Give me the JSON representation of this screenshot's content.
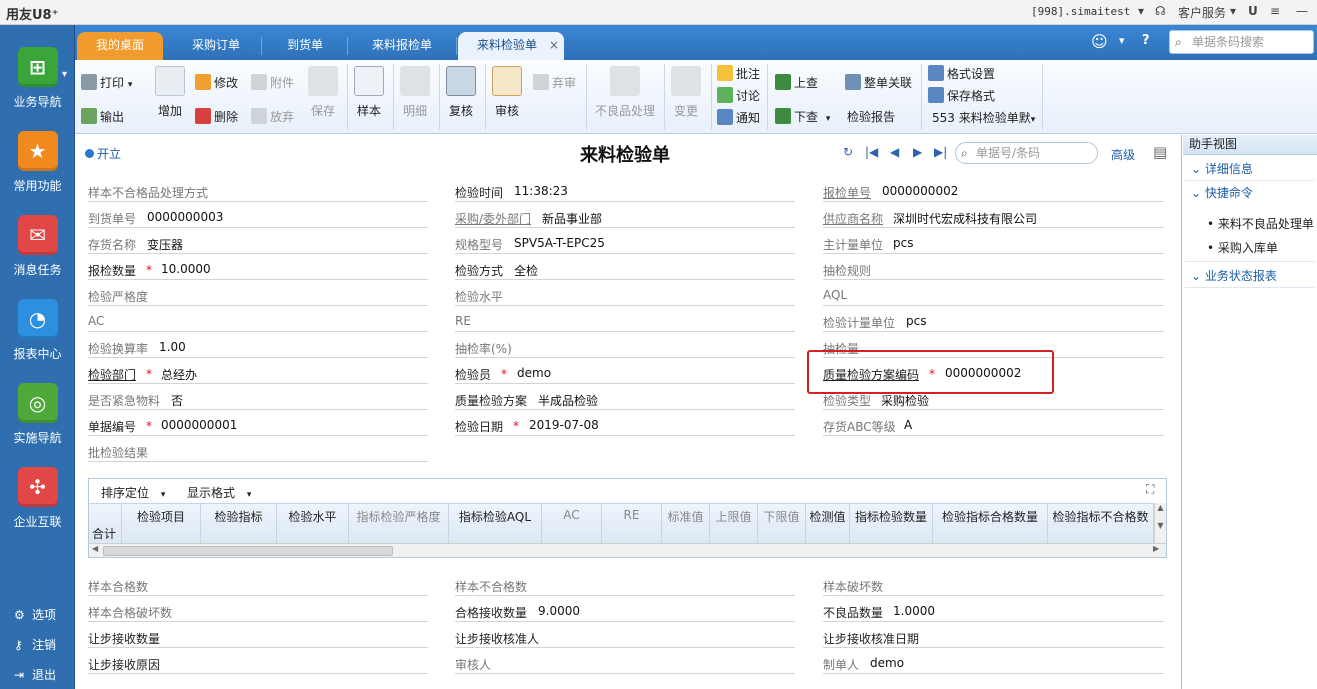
{
  "app": {
    "brand": "用友U8⁺",
    "user_info": "[998].simaitest",
    "customer_service": "客户服务"
  },
  "left_nav": {
    "items": [
      {
        "label": "业务导航",
        "icon": "grid-icon",
        "color": "#3aa63a"
      },
      {
        "label": "常用功能",
        "icon": "star-icon",
        "color": "#f08a1e"
      },
      {
        "label": "消息任务",
        "icon": "mail-icon",
        "color": "#e24747"
      },
      {
        "label": "报表中心",
        "icon": "chart-icon",
        "color": "#2d8fe0"
      },
      {
        "label": "实施导航",
        "icon": "compass-icon",
        "color": "#4ea83a"
      },
      {
        "label": "企业互联",
        "icon": "link-icon",
        "color": "#e24747"
      }
    ],
    "bottom": [
      {
        "label": "选项",
        "icon": "gear-icon"
      },
      {
        "label": "注销",
        "icon": "key-icon"
      },
      {
        "label": "退出",
        "icon": "exit-icon"
      }
    ]
  },
  "tabs": [
    {
      "label": "我的桌面"
    },
    {
      "label": "采购订单"
    },
    {
      "label": "到货单"
    },
    {
      "label": "来料报检单"
    },
    {
      "label": "来料检验单"
    }
  ],
  "search": {
    "placeholder": "单据条码搜索"
  },
  "toolbar": {
    "print": "打印",
    "output": "输出",
    "add": "增加",
    "modify": "修改",
    "delete": "删除",
    "attach": "附件",
    "abandon": "放弃",
    "save": "保存",
    "sample": "样本",
    "detail": "明细",
    "recheck": "复核",
    "audit": "审核",
    "discard": "弃审",
    "defective": "不良品处理",
    "change": "变更",
    "annotate": "批注",
    "discuss": "讨论",
    "notify": "通知",
    "prev_query": "上查",
    "next_query": "下查",
    "bill_link": "整单关联",
    "inspect_report": "检验报告",
    "format_setting": "格式设置",
    "save_format": "保存格式",
    "template": "553 来料检验单默"
  },
  "form": {
    "status": "开立",
    "title": "来料检验单",
    "bill_search_placeholder": "单据号/条码",
    "advanced": "高级",
    "fields": {
      "sample_defect_method": {
        "label": "样本不合格品处理方式",
        "value": ""
      },
      "inspect_time": {
        "label": "检验时间",
        "value": "11:38:23"
      },
      "report_no": {
        "label": "报检单号",
        "value": "0000000002"
      },
      "arrival_no": {
        "label": "到货单号",
        "value": "0000000003"
      },
      "purchase_dept": {
        "label": "采购/委外部门",
        "value": "新品事业部"
      },
      "supplier": {
        "label": "供应商名称",
        "value": "深圳时代宏成科技有限公司"
      },
      "inventory_name": {
        "label": "存货名称",
        "value": "变压器"
      },
      "spec": {
        "label": "规格型号",
        "value": "SPV5A-T-EPC25"
      },
      "main_unit": {
        "label": "主计量单位",
        "value": "pcs"
      },
      "report_qty": {
        "label": "报检数量",
        "value": "10.0000"
      },
      "inspect_method": {
        "label": "检验方式",
        "value": "全检"
      },
      "sampling_rule": {
        "label": "抽检规则",
        "value": ""
      },
      "strictness": {
        "label": "检验严格度",
        "value": ""
      },
      "inspect_level": {
        "label": "检验水平",
        "value": ""
      },
      "aql": {
        "label": "AQL",
        "value": ""
      },
      "ac": {
        "label": "AC",
        "value": ""
      },
      "re": {
        "label": "RE",
        "value": ""
      },
      "inspect_unit": {
        "label": "检验计量单位",
        "value": "pcs"
      },
      "conv_rate": {
        "label": "检验换算率",
        "value": "1.00"
      },
      "sampling_rate": {
        "label": "抽检率(%)",
        "value": ""
      },
      "sampling_qty": {
        "label": "抽检量",
        "value": ""
      },
      "inspect_dept": {
        "label": "检验部门",
        "value": "总经办"
      },
      "inspector": {
        "label": "检验员",
        "value": "demo"
      },
      "plan_code": {
        "label": "质量检验方案编码",
        "value": "0000000002"
      },
      "urgent": {
        "label": "是否紧急物料",
        "value": "否"
      },
      "plan": {
        "label": "质量检验方案",
        "value": "半成品检验"
      },
      "inspect_type": {
        "label": "检验类型",
        "value": "采购检验"
      },
      "doc_no": {
        "label": "单据编号",
        "value": "0000000001"
      },
      "inspect_date": {
        "label": "检验日期",
        "value": "2019-07-08"
      },
      "abc_level": {
        "label": "存货ABC等级",
        "value": "A"
      },
      "batch_result": {
        "label": "批检验结果",
        "value": ""
      },
      "sample_ok": {
        "label": "样本合格数",
        "value": ""
      },
      "sample_ng": {
        "label": "样本不合格数",
        "value": ""
      },
      "sample_broken": {
        "label": "样本破坏数",
        "value": ""
      },
      "sample_ok_broken": {
        "label": "样本合格破坏数",
        "value": ""
      },
      "accept_qty": {
        "label": "合格接收数量",
        "value": "9.0000"
      },
      "defect_qty": {
        "label": "不良品数量",
        "value": "1.0000"
      },
      "concession_qty": {
        "label": "让步接收数量",
        "value": ""
      },
      "concession_approver": {
        "label": "让步接收核准人",
        "value": ""
      },
      "concession_date": {
        "label": "让步接收核准日期",
        "value": ""
      },
      "concession_reason": {
        "label": "让步接收原因",
        "value": ""
      },
      "auditor": {
        "label": "审核人",
        "value": ""
      },
      "creator": {
        "label": "制单人",
        "value": "demo"
      }
    }
  },
  "grid": {
    "sort_label": "排序定位",
    "format_label": "显示格式",
    "total_label": "合计",
    "columns": [
      "检验项目",
      "检验指标",
      "检验水平",
      "指标检验严格度",
      "指标检验AQL",
      "AC",
      "RE",
      "标准值",
      "上限值",
      "下限值",
      "检测值",
      "指标检验数量",
      "检验指标合格数量",
      "检验指标不合格数"
    ]
  },
  "right_panel": {
    "title": "助手视图",
    "sections": [
      "详细信息",
      "快捷命令",
      "业务状态报表"
    ],
    "commands": [
      "来料不良品处理单",
      "采购入库单"
    ]
  }
}
